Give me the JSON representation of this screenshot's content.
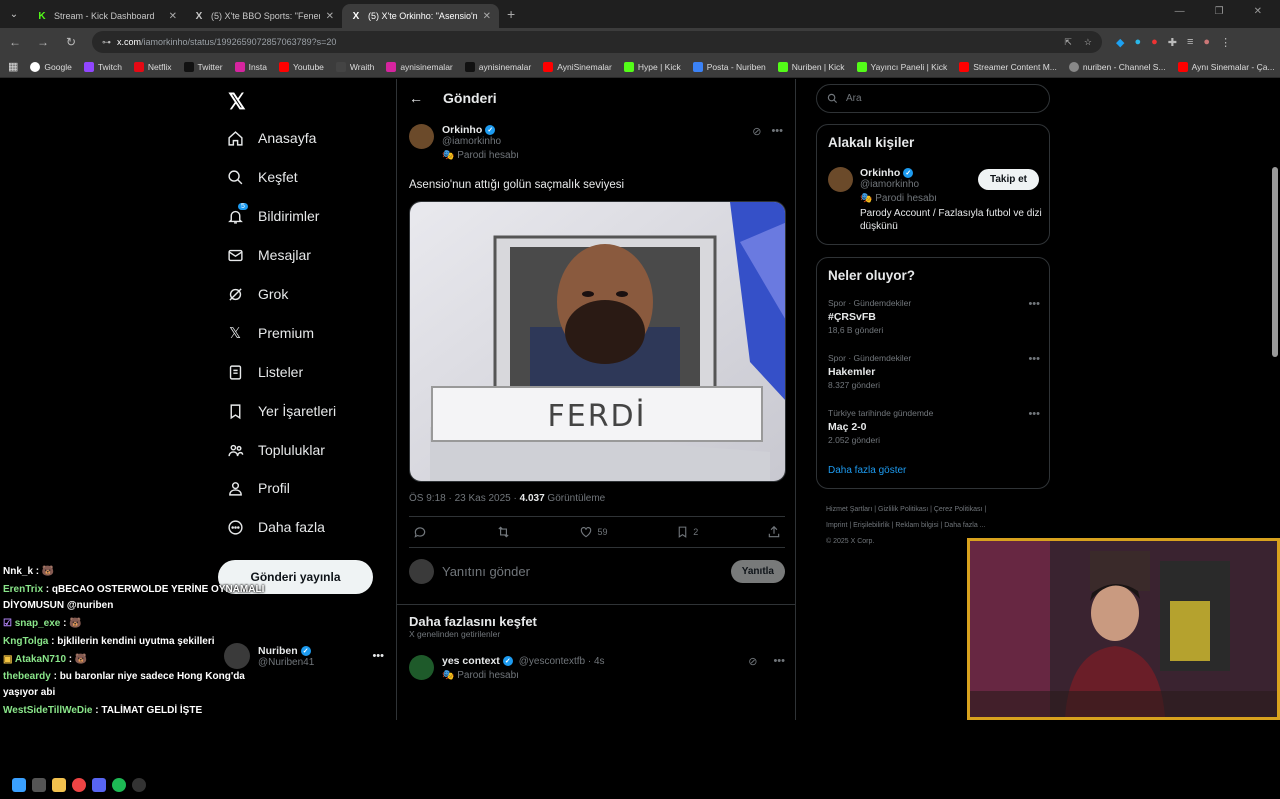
{
  "browser": {
    "tabs": [
      {
        "label": "Stream - Kick Dashboard",
        "favicon": "K",
        "active": false
      },
      {
        "label": "(5) X'te BBO Sports: \"Fener her",
        "favicon": "X",
        "active": false
      },
      {
        "label": "(5) X'te Orkinho: \"Asensio'nun a",
        "favicon": "X",
        "active": true
      }
    ],
    "url_host": "x.com",
    "url_path": "/iamorkinho/status/1992659072857063789?s=20",
    "bookmarks": [
      "Google",
      "Twitch",
      "Netflix",
      "Twitter",
      "Insta",
      "Youtube",
      "Wraith",
      "aynisinemalar",
      "aynisinemalar",
      "AyniSinemalar",
      "Hype | Kick",
      "Posta - Nuriben",
      "Nuriben | Kick",
      "Yayıncı Paneli | Kick",
      "Streamer Content M...",
      "nuriben - Channel S...",
      "Aynı Sinemalar - Ça..."
    ]
  },
  "sidebar": {
    "items": [
      {
        "label": "Anasayfa",
        "icon": "home-icon"
      },
      {
        "label": "Keşfet",
        "icon": "search-icon"
      },
      {
        "label": "Bildirimler",
        "icon": "bell-icon",
        "badge": "5"
      },
      {
        "label": "Mesajlar",
        "icon": "mail-icon"
      },
      {
        "label": "Grok",
        "icon": "grok-icon"
      },
      {
        "label": "Premium",
        "icon": "x-logo-icon"
      },
      {
        "label": "Listeler",
        "icon": "list-icon"
      },
      {
        "label": "Yer İşaretleri",
        "icon": "bookmark-icon"
      },
      {
        "label": "Topluluklar",
        "icon": "people-icon"
      },
      {
        "label": "Profil",
        "icon": "person-icon"
      },
      {
        "label": "Daha fazla",
        "icon": "more-circle-icon"
      }
    ],
    "post_button": "Gönderi yayınla",
    "account_name": "Nuriben",
    "account_handle": "@Nuriben41"
  },
  "post": {
    "header": "Gönderi",
    "author": "Orkinho",
    "handle": "@iamorkinho",
    "parody": "Parodi hesabı",
    "text": "Asensio'nun attığı golün saçmalık seviyesi",
    "image_caption": "FERDİ",
    "time": "ÖS 9:18 · 23 Kas 2025 · ",
    "views": "4.037",
    "views_label": " Görüntüleme",
    "likes": "59",
    "bookmarks": "2",
    "reply_placeholder": "Yanıtını gönder",
    "reply_button": "Yanıtla"
  },
  "discover": {
    "title": "Daha fazlasını keşfet",
    "subtitle": "X genelinden getirilenler",
    "post_author": "yes context",
    "post_handle": "@yescontextfb · 4s",
    "post_parody": "Parodi hesabı"
  },
  "right": {
    "search_placeholder": "Ara",
    "related_title": "Alakalı kişiler",
    "related_name": "Orkinho",
    "related_handle": "@iamorkinho",
    "related_parody": "Parodi hesabı",
    "related_bio": "Parody Account / Fazlasıyla futbol ve dizi düşkünü",
    "follow_button": "Takip et",
    "trends_title": "Neler oluyor?",
    "trends": [
      {
        "category": "Spor · Gündemdekiler",
        "title": "#ÇRSvFB",
        "count": "18,6 B gönderi"
      },
      {
        "category": "Spor · Gündemdekiler",
        "title": "Hakemler",
        "count": "8.327 gönderi"
      },
      {
        "category": "Türkiye tarihinde gündemde",
        "title": "Maç 2-0",
        "count": "2.052 gönderi"
      }
    ],
    "show_more": "Daha fazla göster",
    "footer_line1": "Hizmet Şartları  |  Gizlilik Politikası  |  Çerez Politikası  |",
    "footer_line2": "Imprint  |  Erişilebilirlik  |  Reklam bilgisi  |  Daha fazla ...",
    "footer_line3": "© 2025 X Corp."
  },
  "chat": [
    {
      "user": "Nnk_k",
      "color": "#ffffff",
      "msg": ""
    },
    {
      "user": "ErenTrix",
      "color": "#8ae68a",
      "msg": "qBECAO OSTERWOLDE YERİNE OYNAMALI"
    },
    {
      "user": "",
      "color": "#ffffff",
      "msg": "DİYOMUSUN @nuriben"
    },
    {
      "user": "snap_exe",
      "color": "#8ae68a",
      "msg": ""
    },
    {
      "user": "KngTolga",
      "color": "#8ae68a",
      "msg": "bjklilerin kendini uyutma şekilleri"
    },
    {
      "user": "AtakaN710",
      "color": "#8ae68a",
      "msg": ""
    },
    {
      "user": "thebeardy",
      "color": "#8ae68a",
      "msg": "bu baronlar niye sadece Hong Kong'da"
    },
    {
      "user": "",
      "color": "#ffffff",
      "msg": "yaşıyor abi"
    },
    {
      "user": "WestSideTillWeDie",
      "color": "#8ae68a",
      "msg": "TALİMAT GELDİ İŞTE"
    }
  ]
}
